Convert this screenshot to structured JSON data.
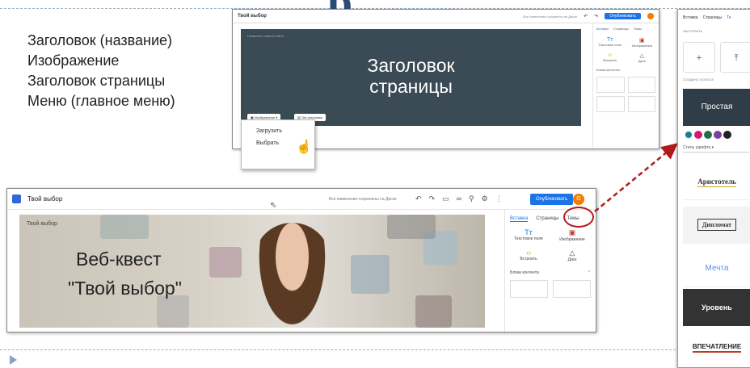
{
  "slide": {
    "title_fragment": "р",
    "notes": [
      "Заголовок (название)",
      "Изображение",
      "Заголовок страницы",
      "Меню (главное меню)"
    ]
  },
  "small_screenshot": {
    "site_name": "Твой выбор",
    "saved_status": "Все изменения сохранены на Диске",
    "publish_label": "Опубликовать",
    "hero_caption": "Заголовок страницы",
    "hero_small": "Название главной сайта",
    "image_button": "Изображение",
    "type_button": "Тип заголовка",
    "side_tabs": [
      "Вставка",
      "Страницы",
      "Темы"
    ],
    "side_items": [
      "Текстовое поле",
      "Изображения",
      "Встроить",
      "Диск"
    ],
    "side_section": "Блоки контента",
    "menu_items": [
      "Загрузить",
      "Выбрать"
    ]
  },
  "large_screenshot": {
    "site_name": "Твой выбор",
    "saved_status": "Все изменения сохранены на Диске",
    "publish_label": "Опубликовать",
    "avatar_letter": "G",
    "hero_small": "Твой выбор",
    "hero_line1": "Веб-квест",
    "hero_line2": "\"Твой выбор\"",
    "side_tabs": [
      "Вставка",
      "Страницы",
      "Темы"
    ],
    "side_items": [
      "Текстовое поле",
      "Изображение",
      "Встроить",
      "Диск"
    ],
    "side_section": "Блоки контента"
  },
  "themes_panel": {
    "tabs": [
      "Вставка",
      "Страницы",
      "Те"
    ],
    "label_custom": "НАСТРОИТЬ",
    "label_google": "СОЗДАНО GOOGLE",
    "font_style": "Стиль шрифта",
    "themes": [
      "Простая",
      "Аристотель",
      "Дипломат",
      "Мечта",
      "Уровень",
      "ВПЕЧАТЛЕНИЕ"
    ],
    "swatch_colors": [
      "#1a7f8c",
      "#d6186e",
      "#1f6f4a",
      "#7b3fa0",
      "#222222"
    ]
  }
}
